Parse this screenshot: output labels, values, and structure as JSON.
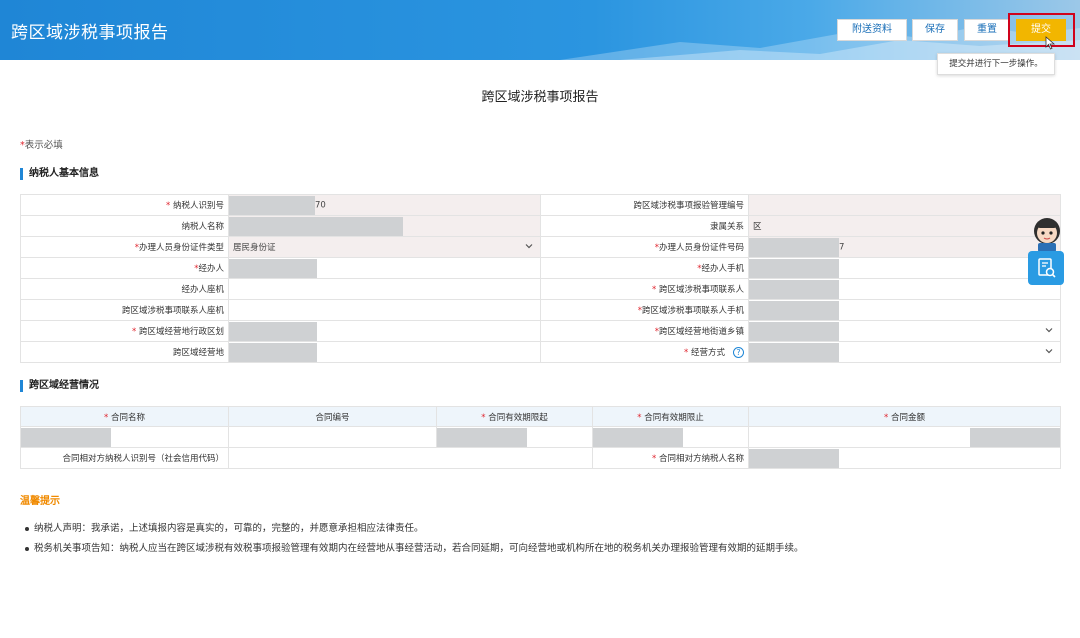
{
  "header": {
    "title": "跨区域涉税事项报告",
    "buttons": {
      "attach": "附送资料",
      "save": "保存",
      "reset": "重置",
      "submit": "提交"
    },
    "tooltip": "提交并进行下一步操作。"
  },
  "page_title": "跨区域涉税事项报告",
  "required_note": {
    "star": "*",
    "text": "表示必填"
  },
  "sections": {
    "basic": "纳税人基本信息",
    "business": "跨区域经营情况",
    "tips": "温馨提示"
  },
  "basic_form": {
    "taxpayer_id": {
      "label": "纳税人识别号",
      "value_suffix": "70"
    },
    "mgmt_no": {
      "label": "跨区域涉税事项报验管理编号",
      "value": ""
    },
    "taxpayer_name": {
      "label": "纳税人名称"
    },
    "affiliation": {
      "label": "隶属关系",
      "value": "区"
    },
    "id_type": {
      "label": "办理人员身份证件类型",
      "value": "居民身份证"
    },
    "id_no": {
      "label": "办理人员身份证件号码",
      "value_suffix": "7"
    },
    "handler": {
      "label": "经办人"
    },
    "handler_mobile": {
      "label": "经办人手机"
    },
    "handler_phone": {
      "label": "经办人座机"
    },
    "contact": {
      "label": "跨区域涉税事项联系人"
    },
    "contact_phone": {
      "label": "跨区域涉税事项联系人座机"
    },
    "contact_mobile": {
      "label": "跨区域涉税事项联系人手机"
    },
    "region": {
      "label": "跨区域经营地行政区划"
    },
    "street": {
      "label": "跨区域经营地街道乡镇"
    },
    "address": {
      "label": "跨区域经营地"
    },
    "mode": {
      "label": "经营方式",
      "help": "?"
    }
  },
  "business_table": {
    "headers": [
      "合同名称",
      "合同编号",
      "合同有效期限起",
      "合同有效期限止",
      "合同金额"
    ],
    "required": [
      true,
      false,
      true,
      true,
      true
    ],
    "counterparty_id_label": "合同相对方纳税人识别号（社会信用代码）",
    "counterparty_name_label": "合同相对方纳税人名称"
  },
  "tips": [
    "纳税人声明：我承诺，上述填报内容是真实的，可靠的，完整的，并愿意承担相应法律责任。",
    "税务机关事项告知：纳税人应当在跨区域涉税有效税事项报验管理有效期内在经营地从事经营活动，若合同延期，可向经营地或机构所在地的税务机关办理报验管理有效期的延期手续。"
  ],
  "icons": {
    "avatar": "assistant-avatar-icon",
    "search_doc": "search-document-icon",
    "chevron": "chevron-down-icon",
    "cursor": "mouse-cursor-icon"
  },
  "colors": {
    "header": "#1f86d6",
    "submit": "#f2b600",
    "required": "#e0252e",
    "tips_title": "#f08a00",
    "highlight": "#d0021b"
  }
}
